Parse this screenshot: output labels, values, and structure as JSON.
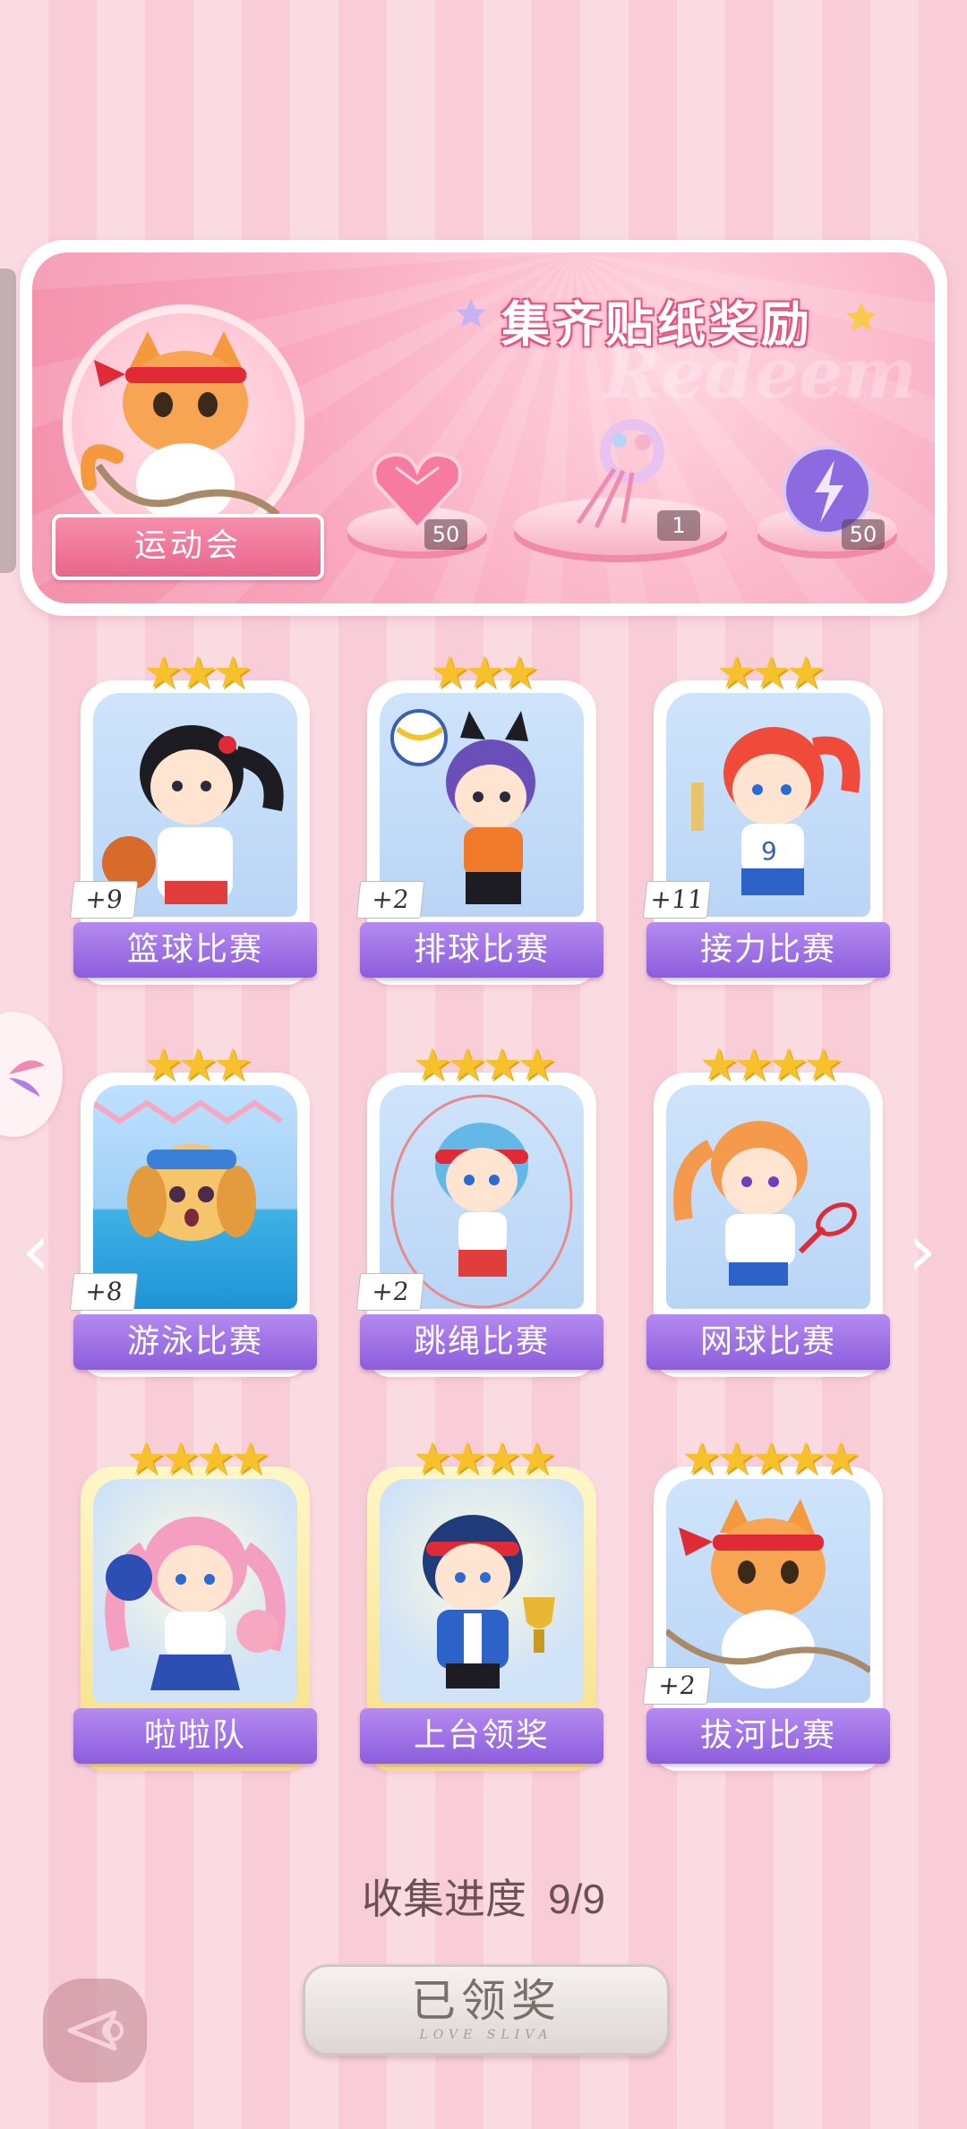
{
  "banner": {
    "title": "集齐贴纸奖励",
    "watermark": "Redeem",
    "event_label": "运动会",
    "rewards": [
      {
        "name": "pink-heart-gem-icon",
        "count": "50"
      },
      {
        "name": "ribbon-wreath-icon",
        "count": "1"
      },
      {
        "name": "purple-lightning-orb-icon",
        "count": "50"
      }
    ]
  },
  "cards": [
    {
      "label": "篮球比赛",
      "stars": "★★★",
      "plus": "+9"
    },
    {
      "label": "排球比赛",
      "stars": "★★★",
      "plus": "+2"
    },
    {
      "label": "接力比赛",
      "stars": "★★★",
      "plus": "+11"
    },
    {
      "label": "游泳比赛",
      "stars": "★★★",
      "plus": "+8"
    },
    {
      "label": "跳绳比赛",
      "stars": "★★★★",
      "plus": "+2"
    },
    {
      "label": "网球比赛",
      "stars": "★★★★",
      "plus": ""
    },
    {
      "label": "啦啦队",
      "stars": "★★★★",
      "plus": ""
    },
    {
      "label": "上台领奖",
      "stars": "★★★★",
      "plus": ""
    },
    {
      "label": "拔河比赛",
      "stars": "★★★★★",
      "plus": "+2"
    }
  ],
  "progress": {
    "label": "收集进度",
    "value": "9/9"
  },
  "claim_button": {
    "label": "已领奖",
    "sub": "LOVE SLIVA"
  },
  "colors": {
    "accent_purple": "#8c5ddc",
    "accent_pink": "#e9658c",
    "star_gold": "#f6c12b"
  }
}
